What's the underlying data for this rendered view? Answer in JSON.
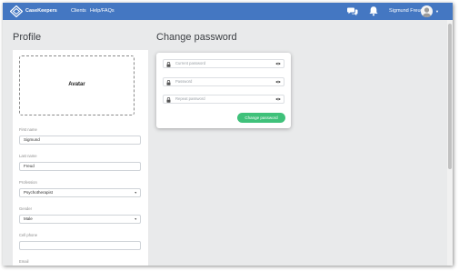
{
  "brand": {
    "name": "CaseKeepers",
    "icon": "diamond-logo-icon"
  },
  "nav": {
    "links": [
      "Clients",
      "Help/FAQs"
    ],
    "user_name": "Sigmund Freud",
    "icons": [
      "chat-icon",
      "bell-icon",
      "user-avatar-icon",
      "chevron-down-icon"
    ]
  },
  "colors": {
    "topbar": "#4477c2",
    "background": "#e9eaeb",
    "primary_button": "#3fc17a"
  },
  "profile": {
    "heading": "Profile",
    "avatar_label": "Avatar",
    "fields": [
      {
        "label": "First name",
        "value": "Sigmund"
      },
      {
        "label": "Last name",
        "value": "Freud"
      },
      {
        "label": "Profession",
        "value": "Psychotherapist",
        "type": "select"
      },
      {
        "label": "Gender",
        "value": "Male",
        "type": "select"
      },
      {
        "label": "Cell phone",
        "value": ""
      },
      {
        "label": "Email",
        "value": ""
      }
    ]
  },
  "change_password": {
    "heading": "Change password",
    "fields": [
      {
        "placeholder": "Current password"
      },
      {
        "placeholder": "Password"
      },
      {
        "placeholder": "Repeat password"
      }
    ],
    "submit_label": "Change password"
  }
}
